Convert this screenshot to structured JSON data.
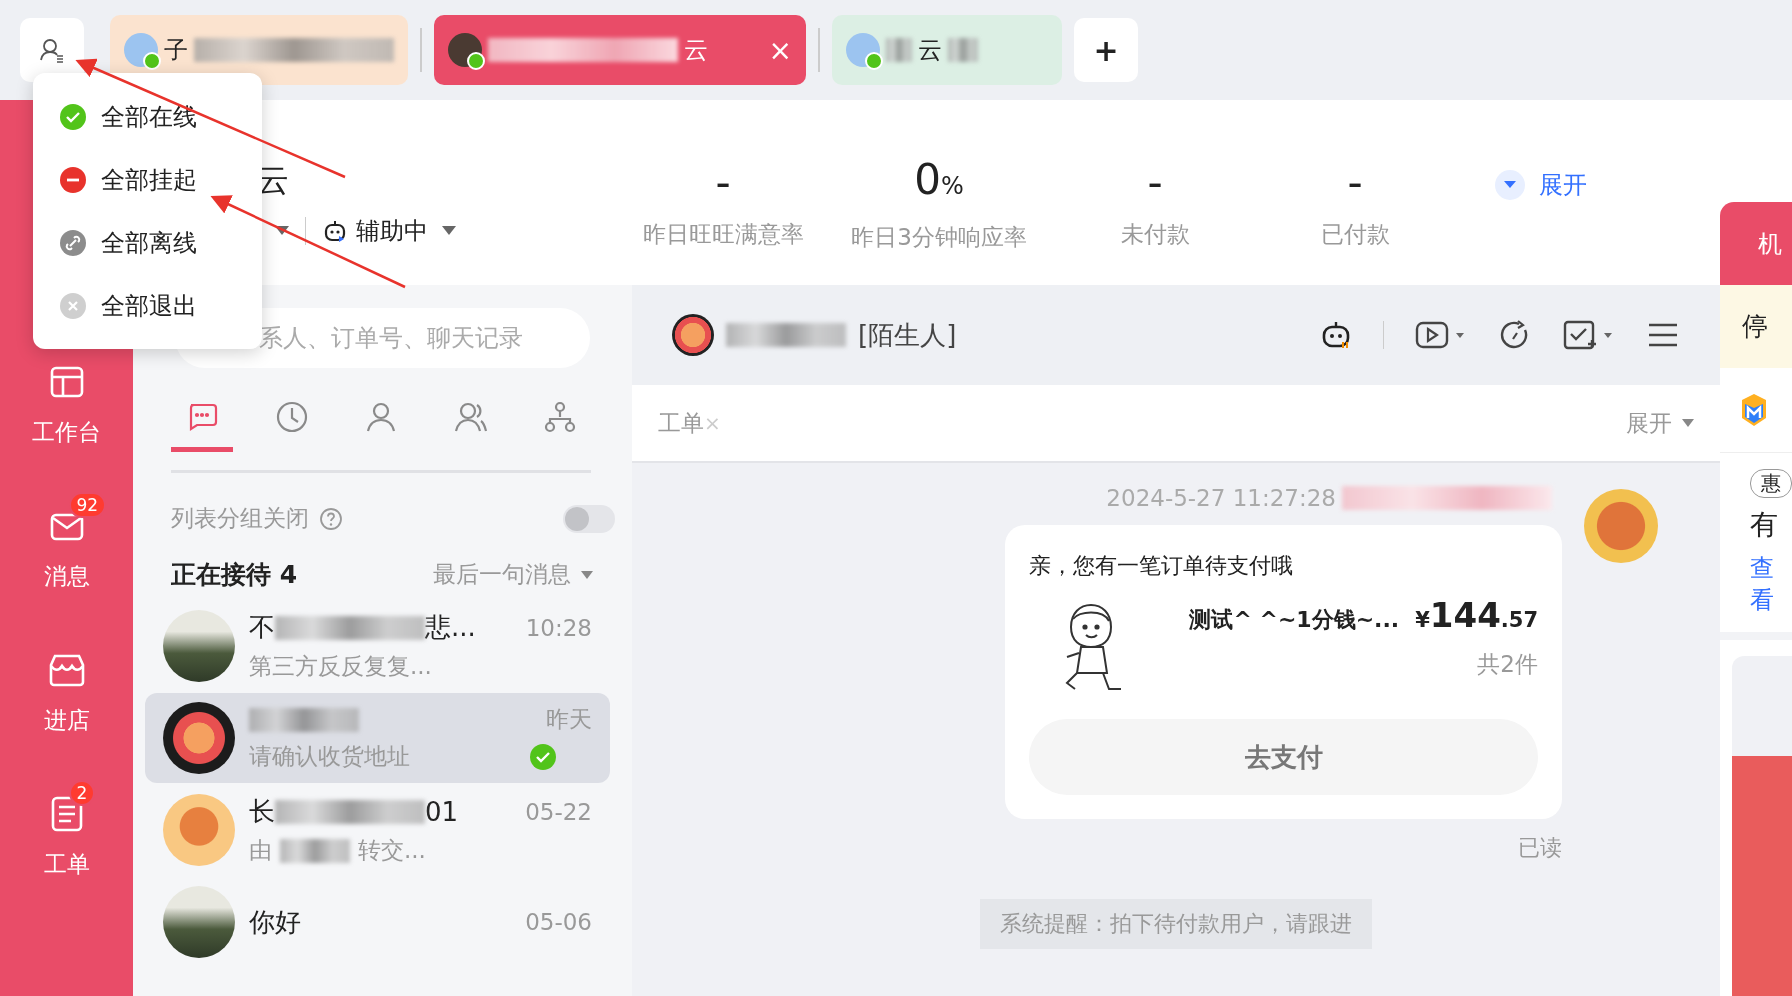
{
  "tabs_bar": {
    "close": "×",
    "add": "+",
    "tabs": [
      {
        "label": "子",
        "selected": false,
        "color": "#fbe3cf"
      },
      {
        "label": "云",
        "selected": true,
        "color": "#e94c68"
      },
      {
        "label": "云",
        "selected": false,
        "color": "#dcefe4"
      }
    ]
  },
  "status_menu": {
    "items": [
      {
        "label": "全部在线",
        "kind": "online"
      },
      {
        "label": "全部挂起",
        "kind": "busy"
      },
      {
        "label": "全部离线",
        "kind": "offline"
      },
      {
        "label": "全部退出",
        "kind": "exit"
      }
    ]
  },
  "sidebar": {
    "items": [
      {
        "label": "工作台",
        "kind": "workbench"
      },
      {
        "label": "消息",
        "kind": "message",
        "badge": "92"
      },
      {
        "label": "进店",
        "kind": "store"
      },
      {
        "label": "工单",
        "kind": "ticket",
        "badge": "2"
      }
    ]
  },
  "shop": {
    "name": "云",
    "status": "辅助中"
  },
  "stats": {
    "expand": "展开",
    "items": [
      {
        "value": "-",
        "label": "昨日旺旺满意率"
      },
      {
        "value": "0",
        "unit": "%",
        "label": "昨日3分钟响应率"
      },
      {
        "value": "-",
        "label": "未付款"
      },
      {
        "value": "-",
        "label": "已付款"
      }
    ]
  },
  "conversations": {
    "search": {
      "placeholder": "系人、订单号、聊天记录"
    },
    "nav_tabs": [
      {
        "kind": "chat",
        "selected": true
      },
      {
        "kind": "history",
        "selected": false
      },
      {
        "kind": "contact",
        "selected": false
      },
      {
        "kind": "group",
        "selected": false
      },
      {
        "kind": "org",
        "selected": false
      }
    ],
    "grouping": {
      "label": "列表分组关闭",
      "on": false
    },
    "section": {
      "title": "正在接待",
      "count": "4",
      "sort": "最后一句消息"
    },
    "items": [
      {
        "name_parts": [
          "不",
          "悲..."
        ],
        "time": "10:28",
        "preview_parts": [
          "第三方反反复复..."
        ],
        "kind": "photo",
        "selected": false,
        "replied": false
      },
      {
        "time": "昨天",
        "preview_parts": [
          "请确认收货地址"
        ],
        "kind": "product",
        "selected": true,
        "replied": true
      },
      {
        "name_parts": [
          "长",
          "01"
        ],
        "time": "05-22",
        "preview_parts": [
          "由",
          "转交..."
        ],
        "kind": "mascot",
        "selected": false,
        "replied": false
      },
      {
        "name_parts": [
          "你好"
        ],
        "time": "05-06",
        "kind": "photo",
        "selected": false
      }
    ]
  },
  "chat": {
    "contact_tag": "[陌生人]",
    "ticket_bar": {
      "label": "工单",
      "close": "×",
      "expand": "展开"
    },
    "timestamp": "2024-5-27 11:27:28",
    "card": {
      "title": "亲，您有一笔订单待支付哦",
      "product": "测试^ ^~1分钱~...",
      "currency": "¥",
      "price_int": "144",
      "price_dec": ".57",
      "count": "共2件",
      "button": "去支付"
    },
    "read": "已读",
    "system_notice": "系统提醒：拍下待付款用户，请跟进"
  },
  "right_panel": {
    "tab": "机",
    "notice": "停",
    "tag": "惠",
    "text": "有",
    "link": "查看"
  }
}
